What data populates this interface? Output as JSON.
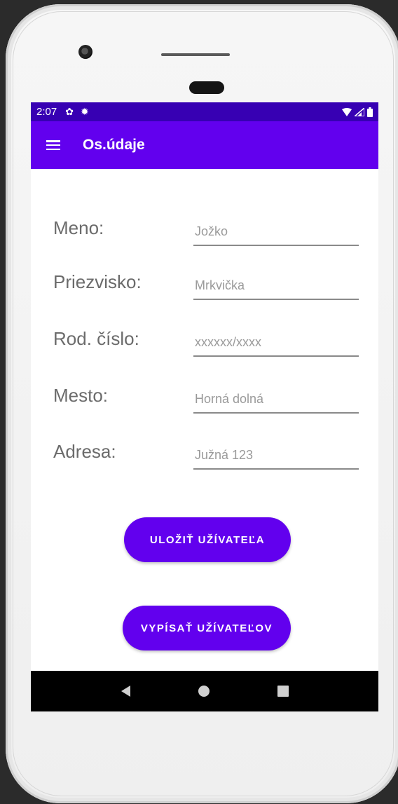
{
  "status_bar": {
    "time": "2:07",
    "left_icons": [
      "gear-icon",
      "settings-sun-icon"
    ],
    "right_icons": [
      "wifi-icon",
      "signal-icon",
      "battery-icon"
    ]
  },
  "app_bar": {
    "title": "Os.údaje",
    "menu_icon": "hamburger-menu-icon",
    "color": "#6200ee",
    "status_color": "#3700b3"
  },
  "form": {
    "fields": [
      {
        "label": "Meno:",
        "placeholder": "Jožko"
      },
      {
        "label": "Priezvisko:",
        "placeholder": "Mrkvička"
      },
      {
        "label": "Rod. číslo:",
        "placeholder": "xxxxxx/xxxx"
      },
      {
        "label": "Mesto:",
        "placeholder": "Horná dolná"
      },
      {
        "label": "Adresa:",
        "placeholder": "Južná 123"
      }
    ]
  },
  "buttons": {
    "save_label": "ULOŽIŤ UŽÍVATEĽA",
    "list_label": "VYPÍSAŤ UŽÍVATEĽOV"
  },
  "nav_bar": {
    "icons": [
      "back-icon",
      "home-icon",
      "recents-icon"
    ]
  }
}
